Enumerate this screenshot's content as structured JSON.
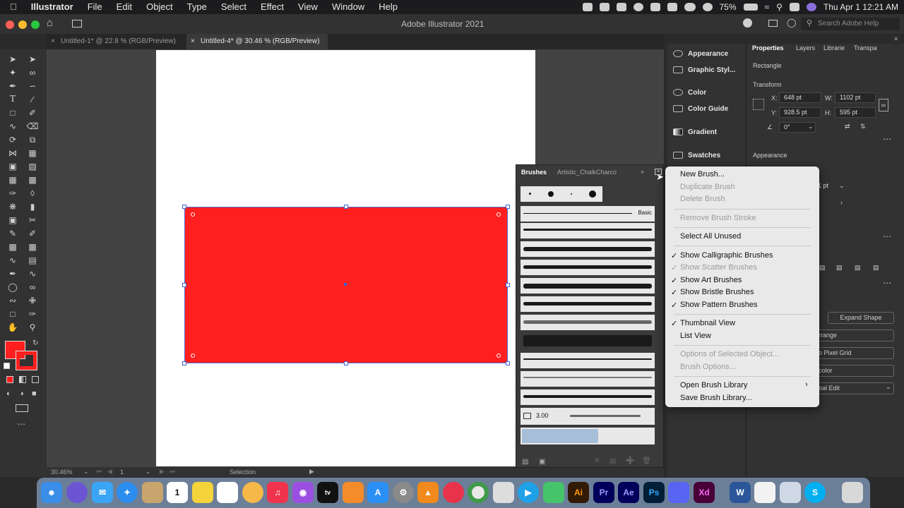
{
  "menubar": {
    "items": [
      "Illustrator",
      "File",
      "Edit",
      "Object",
      "Type",
      "Select",
      "Effect",
      "View",
      "Window",
      "Help"
    ],
    "battery": "75%",
    "datetime": "Thu Apr 1  12:21 AM"
  },
  "window": {
    "title": "Adobe Illustrator 2021",
    "search_placeholder": "Search Adobe Help"
  },
  "tabs": [
    "Untitled-1* @ 22.8 % (RGB/Preview)",
    "Untitled-4* @ 30.46 % (RGB/Preview)"
  ],
  "status": {
    "zoom": "30.46%",
    "page": "1",
    "tool": "Selection"
  },
  "colors": {
    "fill": "#ff1f1f",
    "selection": "#3f64d6"
  },
  "brushes_panel": {
    "tabs": [
      "Brushes",
      "Artistic_ChalkCharco"
    ],
    "basic_label": "Basic",
    "stroke_weight": "3.00"
  },
  "mid_panels": [
    "Appearance",
    "Graphic Styl...",
    "Color",
    "Color Guide",
    "Gradient",
    "Swatches"
  ],
  "properties": {
    "tabs": [
      "Properties",
      "Layers",
      "Librarie",
      "Transpa"
    ],
    "object_type": "Rectangle",
    "transform_title": "Transform",
    "x_label": "X:",
    "x": "648 pt",
    "y_label": "Y:",
    "y": "928.5 pt",
    "w_label": "W:",
    "w": "1102 pt",
    "h_label": "H:",
    "h": "595 pt",
    "rotation": "0°",
    "appearance_title": "Appearance",
    "stroke_value": "1 pt",
    "expand_shape": "Expand Shape",
    "arrange": "rrange",
    "pixel_grid": "o Pixel Grid",
    "recolor": "color",
    "global_edit": "bal Edit"
  },
  "context_menu": {
    "new_brush": "New Brush...",
    "duplicate_brush": "Duplicate Brush",
    "delete_brush": "Delete Brush",
    "remove_brush_stroke": "Remove Brush Stroke",
    "select_all_unused": "Select All Unused",
    "show_calligraphic": "Show Calligraphic Brushes",
    "show_scatter": "Show Scatter Brushes",
    "show_art": "Show Art Brushes",
    "show_bristle": "Show Bristle Brushes",
    "show_pattern": "Show Pattern Brushes",
    "thumbnail_view": "Thumbnail View",
    "list_view": "List View",
    "options_selected": "Options of Selected Object...",
    "brush_options": "Brush Options...",
    "open_library": "Open Brush Library",
    "save_library": "Save Brush Library..."
  },
  "dock": {
    "apps": [
      "Ai",
      "Pr",
      "Ae",
      "Ps",
      "Xd",
      "S"
    ]
  }
}
